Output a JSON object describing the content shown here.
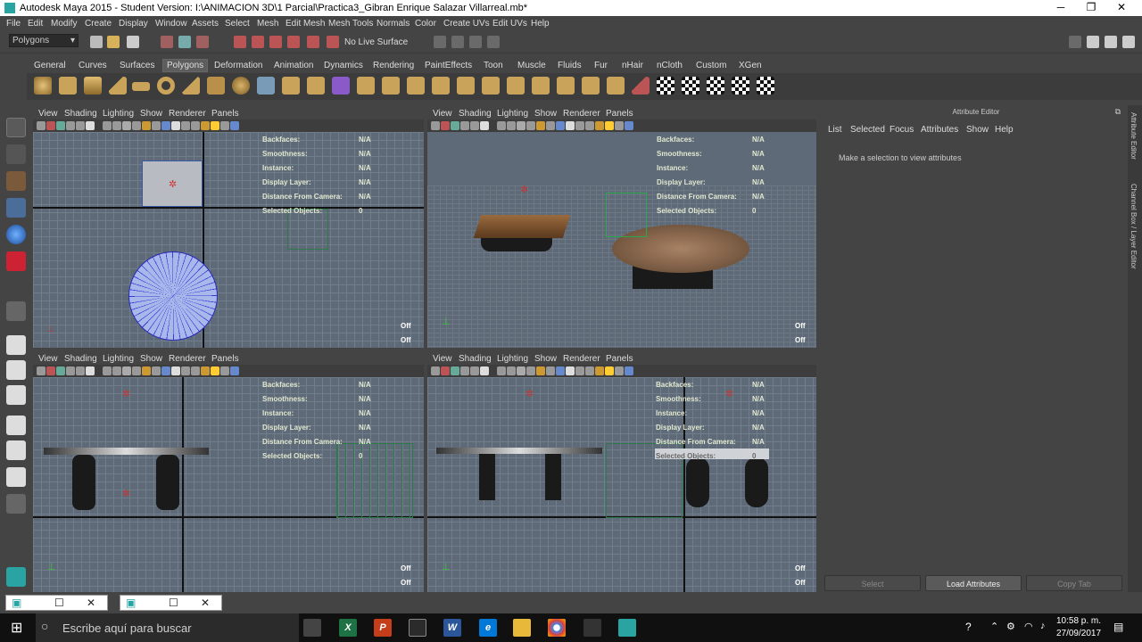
{
  "window": {
    "title": "Autodesk Maya 2015 - Student Version: I:\\ANIMACION 3D\\1 Parcial\\Practica3_Gibran Enrique Salazar Villarreal.mb*",
    "min": "─",
    "max": "❐",
    "close": "✕"
  },
  "menu": [
    "File",
    "Edit",
    "Modify",
    "Create",
    "Display",
    "Window",
    "Assets",
    "Select",
    "Mesh",
    "Edit Mesh",
    "Mesh Tools",
    "Normals",
    "Color",
    "Create UVs",
    "Edit UVs",
    "Help"
  ],
  "status": {
    "mode": "Polygons",
    "live_surface": "No Live Surface"
  },
  "shelf_tabs": [
    "General",
    "Curves",
    "Surfaces",
    "Polygons",
    "Deformation",
    "Animation",
    "Dynamics",
    "Rendering",
    "PaintEffects",
    "Toon",
    "Muscle",
    "Fluids",
    "Fur",
    "nHair",
    "nCloth",
    "Custom",
    "XGen"
  ],
  "shelf_active": "Polygons",
  "viewport_menu": [
    "View",
    "Shading",
    "Lighting",
    "Show",
    "Renderer",
    "Panels"
  ],
  "hud": {
    "labels": [
      "Backfaces:",
      "Smoothness:",
      "Instance:",
      "Display Layer:",
      "Distance From Camera:",
      "Selected Objects:"
    ],
    "values": [
      "N/A",
      "N/A",
      "N/A",
      "N/A",
      "N/A",
      "0"
    ],
    "off": "Off"
  },
  "attribute_editor": {
    "title": "Attribute Editor",
    "menu": [
      "List",
      "Selected",
      "Focus",
      "Attributes",
      "Show",
      "Help"
    ],
    "message": "Make a selection to view attributes",
    "buttons": {
      "select": "Select",
      "load": "Load Attributes",
      "copy": "Copy Tab"
    }
  },
  "side_tabs": {
    "attr": "Attribute Editor",
    "channel": "Channel Box / Layer Editor"
  },
  "taskbar": {
    "search": "Escribe aquí para buscar",
    "time": "10:58 p. m.",
    "date": "27/09/2017"
  }
}
